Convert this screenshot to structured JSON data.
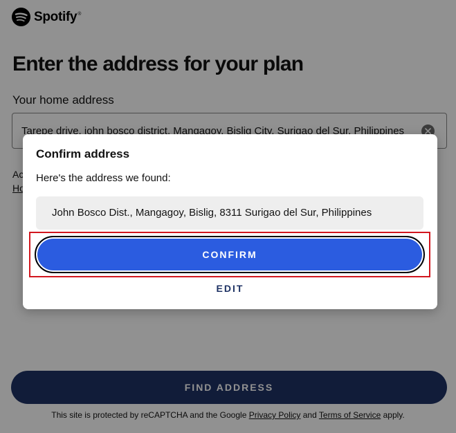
{
  "header": {
    "brand": "Spotify",
    "trademark": "®",
    "logo_icon": "spotify-logo-icon"
  },
  "page": {
    "title": "Enter the address for your plan",
    "field_label": "Your home address",
    "address_value": "Tarepe drive, john bosco district, Mangagoy, Bislig City, Surigao del Sur, Philippines",
    "clear_icon": "clear-x-icon",
    "partial_text_line1": "Ac",
    "partial_text_line2": "Ho"
  },
  "dialog": {
    "title": "Confirm address",
    "subtitle": "Here's the address we found:",
    "found_address": "John Bosco Dist., Mangagoy, Bislig, 8311 Surigao del Sur, Philippines",
    "confirm_label": "CONFIRM",
    "edit_label": "EDIT"
  },
  "footer": {
    "find_address_label": "FIND ADDRESS",
    "recaptcha_prefix": "This site is protected by reCAPTCHA and the Google",
    "privacy_policy": "Privacy Policy",
    "and_text": "and",
    "terms_of_service": "Terms of Service",
    "suffix": "apply."
  },
  "colors": {
    "primary_button": "#2b5ce0",
    "dark_button": "#1e3264",
    "highlight_border": "#d2161e"
  }
}
